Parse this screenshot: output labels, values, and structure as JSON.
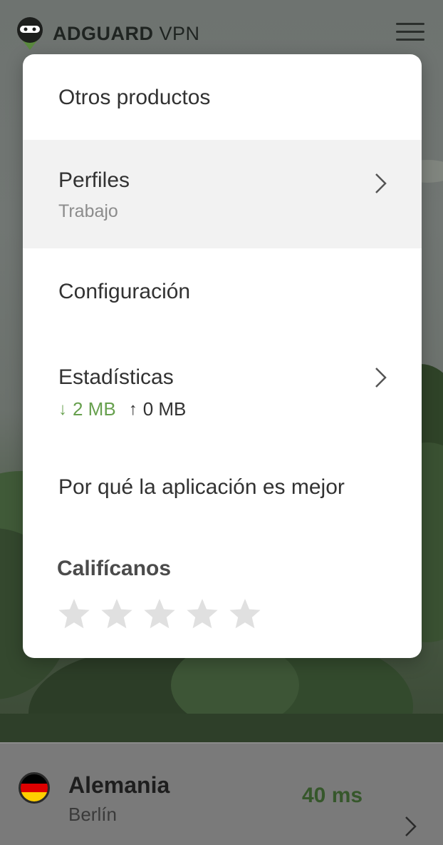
{
  "header": {
    "brand_bold": "ADGUARD",
    "brand_light": "VPN",
    "menu_icon": "hamburger-icon"
  },
  "menu": {
    "other_products": "Otros productos",
    "profiles": {
      "label": "Perfiles",
      "value": "Trabajo"
    },
    "settings": "Configuración",
    "statistics": {
      "label": "Estadísticas",
      "download": "2 MB",
      "upload": "0 MB",
      "download_icon": "arrow-down-icon",
      "upload_icon": "arrow-up-icon"
    },
    "why_better": "Por qué la aplicación es mejor",
    "rate": {
      "title": "Califícanos",
      "stars": 5,
      "rating": 0
    }
  },
  "location": {
    "country": "Alemania",
    "city": "Berlín",
    "ping": "40 ms",
    "flag_icon": "germany-flag-icon"
  },
  "colors": {
    "accent_green": "#67a04e",
    "ping_green": "#36572b",
    "menu_bg": "#ffffff",
    "selected_bg": "#f2f2f2",
    "star_inactive": "#e0e0e0"
  }
}
